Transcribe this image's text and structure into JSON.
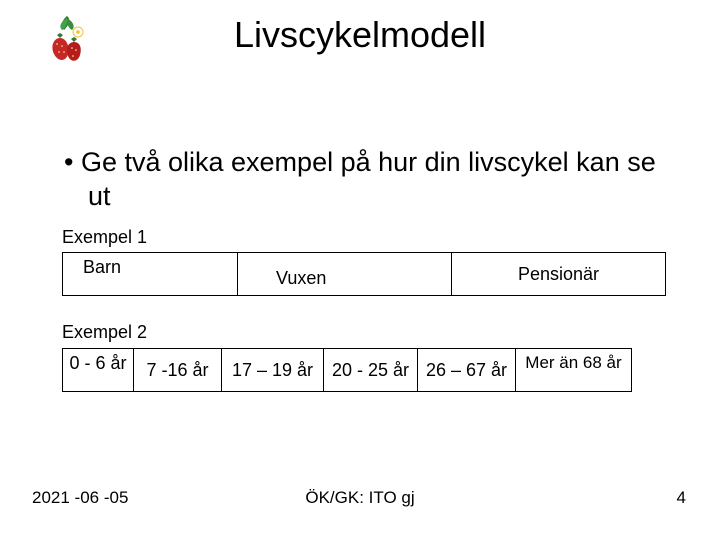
{
  "title": "Livscykelmodell",
  "bullet_text": "• Ge två olika exempel på hur din livscykel kan se ut",
  "example1": {
    "label": "Exempel 1",
    "cells": [
      "Barn",
      "Vuxen",
      "Pensionär"
    ]
  },
  "example2": {
    "label": "Exempel 2",
    "cells": [
      "0 - 6 år",
      "7 -16 år",
      "17 – 19 år",
      "20 - 25 år",
      "26 – 67 år",
      "Mer än 68 år"
    ]
  },
  "footer": {
    "date": "2021 -06 -05",
    "center": "ÖK/GK: ITO gj",
    "page": "4"
  },
  "icons": {
    "logo": "strawberry-plant-icon"
  }
}
